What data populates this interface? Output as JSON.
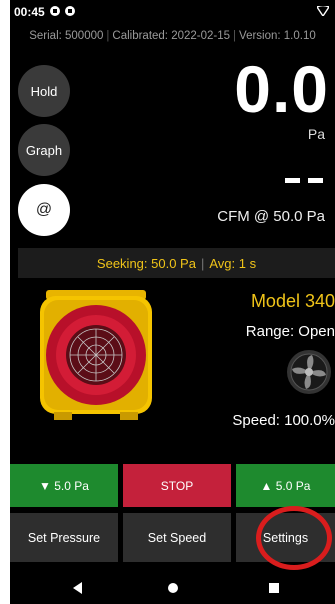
{
  "status_bar": {
    "time": "00:45",
    "icons": [
      "app-notification-icon",
      "app-notification-icon",
      "wifi-icon"
    ]
  },
  "info_bar": {
    "serial": "Serial: 500000",
    "calibrated": "Calibrated: 2022-02-15",
    "version": "Version: 1.0.10"
  },
  "side_buttons": {
    "hold": "Hold",
    "graph": "Graph",
    "at": "@"
  },
  "pressure": {
    "value": "0.0",
    "unit": "Pa"
  },
  "cfm_label": "CFM @ 50.0 Pa",
  "seek_bar": {
    "seeking": "Seeking: 50.0 Pa",
    "avg": "Avg: 1 s"
  },
  "device": {
    "model": "Model 340",
    "range": "Range: Open",
    "speed": "Speed: 100.0%"
  },
  "controls": {
    "decrease": "▼ 5.0 Pa",
    "stop": "STOP",
    "increase": "▲ 5.0 Pa"
  },
  "bottom_buttons": {
    "set_pressure": "Set Pressure",
    "set_speed": "Set Speed",
    "settings": "Settings"
  },
  "colors": {
    "accent_yellow": "#f0c419",
    "green": "#1e8a2e",
    "stop_red": "#c4213b",
    "highlight_red": "#d91d1d"
  }
}
